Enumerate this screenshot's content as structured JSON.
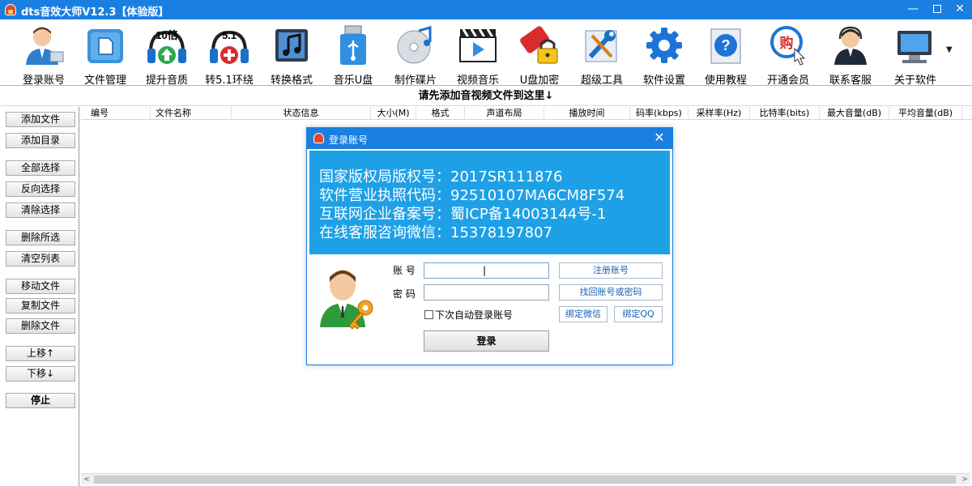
{
  "window": {
    "title": "dts音效大师V12.3【体验版】",
    "minimize": "—",
    "close": "✕"
  },
  "toolbar": {
    "items": [
      {
        "label": "登录账号",
        "icon": "user-icon"
      },
      {
        "label": "文件管理",
        "icon": "folder-icon"
      },
      {
        "label": "提升音质",
        "icon": "headphones-up-icon",
        "badge": "10倍"
      },
      {
        "label": "转5.1环绕",
        "icon": "headphones-plus-icon",
        "badge": "5.1"
      },
      {
        "label": "转换格式",
        "icon": "music-note-icon"
      },
      {
        "label": "音乐U盘",
        "icon": "usb-drive-icon"
      },
      {
        "label": "制作碟片",
        "icon": "disc-icon"
      },
      {
        "label": "视频音乐",
        "icon": "video-icon"
      },
      {
        "label": "U盘加密",
        "icon": "usb-lock-icon"
      },
      {
        "label": "超级工具",
        "icon": "tools-icon"
      },
      {
        "label": "软件设置",
        "icon": "gear-icon"
      },
      {
        "label": "使用教程",
        "icon": "help-icon"
      },
      {
        "label": "开通会员",
        "icon": "member-icon",
        "badge": "购"
      },
      {
        "label": "联系客服",
        "icon": "support-icon"
      },
      {
        "label": "关于软件",
        "icon": "computer-icon"
      }
    ],
    "more": "▼"
  },
  "dropbar": {
    "text": "请先添加音视频文件到这里↓"
  },
  "sidebar": {
    "buttons": [
      "添加文件",
      "添加目录",
      "全部选择",
      "反向选择",
      "清除选择",
      "删除所选",
      "清空列表",
      "移动文件",
      "复制文件",
      "删除文件",
      "上移↑",
      "下移↓",
      "停止"
    ]
  },
  "list": {
    "columns": [
      "编号",
      "文件名称",
      "状态信息",
      "大小(M)",
      "格式",
      "声道布局",
      "播放时间",
      "码率(kbps)",
      "采样率(Hz)",
      "比特率(bits)",
      "最大音量(dB)",
      "平均音量(dB)"
    ],
    "scroll_left": "<",
    "scroll_right": ">"
  },
  "dialog": {
    "title": "登录账号",
    "close": "✕",
    "banner_lines": [
      "国家版权局版权号：2017SR111876",
      "软件营业执照代码：92510107MA6CM8F574",
      "互联网企业备案号：蜀ICP备14003144号-1",
      "在线客服咨询微信：15378197807"
    ],
    "account_label": "账 号",
    "password_label": "密 码",
    "account_value": "|",
    "register": "注册账号",
    "recover": "找回账号或密码",
    "auto_login": "下次自动登录账号",
    "bind_wechat": "绑定微信",
    "bind_qq": "绑定QQ",
    "login": "登录"
  },
  "colors": {
    "accent": "#1a7fe0",
    "banner": "#1ea0e6"
  }
}
